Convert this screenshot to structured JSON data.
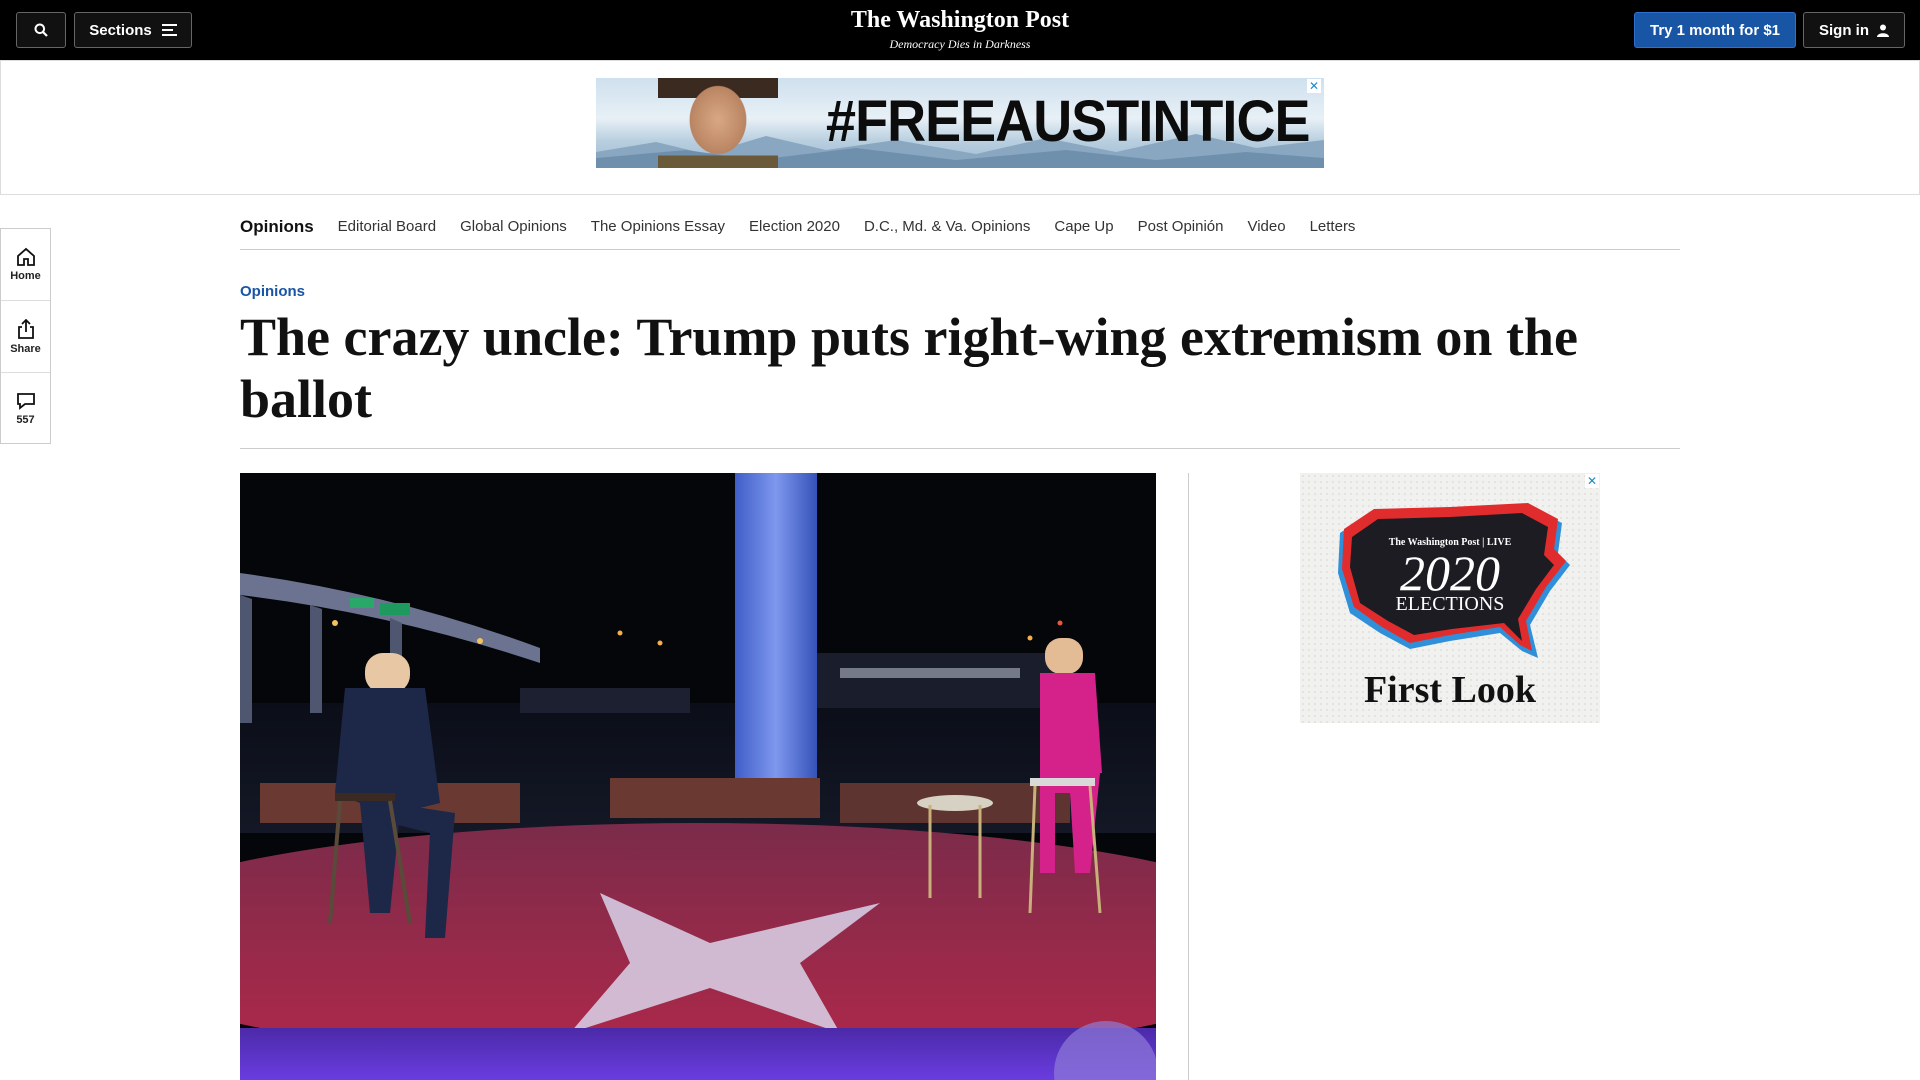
{
  "header": {
    "search_icon": "search-icon",
    "sections_label": "Sections",
    "logo_title": "The Washington Post",
    "logo_tagline": "Democracy Dies in Darkness",
    "subscribe_label": "Try 1 month for $1",
    "signin_label": "Sign in"
  },
  "top_ad": {
    "text": "#FREEAUSTINTICE",
    "close": "✕"
  },
  "rail": {
    "items": [
      {
        "label": "Home",
        "icon": "home-icon"
      },
      {
        "label": "Share",
        "icon": "share-icon"
      },
      {
        "label": "557",
        "icon": "comment-icon"
      }
    ]
  },
  "section_nav": {
    "items": [
      {
        "label": "Opinions"
      },
      {
        "label": "Editorial Board"
      },
      {
        "label": "Global Opinions"
      },
      {
        "label": "The Opinions Essay"
      },
      {
        "label": "Election 2020"
      },
      {
        "label": "D.C., Md. & Va. Opinions"
      },
      {
        "label": "Cape Up"
      },
      {
        "label": "Post Opinión"
      },
      {
        "label": "Video"
      },
      {
        "label": "Letters"
      }
    ]
  },
  "article": {
    "kicker": "Opinions",
    "headline": "The crazy uncle: Trump puts right-wing extremism on the ballot"
  },
  "side_ad": {
    "brand": "The Washington Post | LIVE",
    "year": "2020",
    "elections": "ELECTIONS",
    "tagline": "First Look",
    "close": "✕"
  },
  "colors": {
    "header_bg": "#000000",
    "subscribe_blue": "#1955a5",
    "kicker_blue": "#1955a5"
  }
}
